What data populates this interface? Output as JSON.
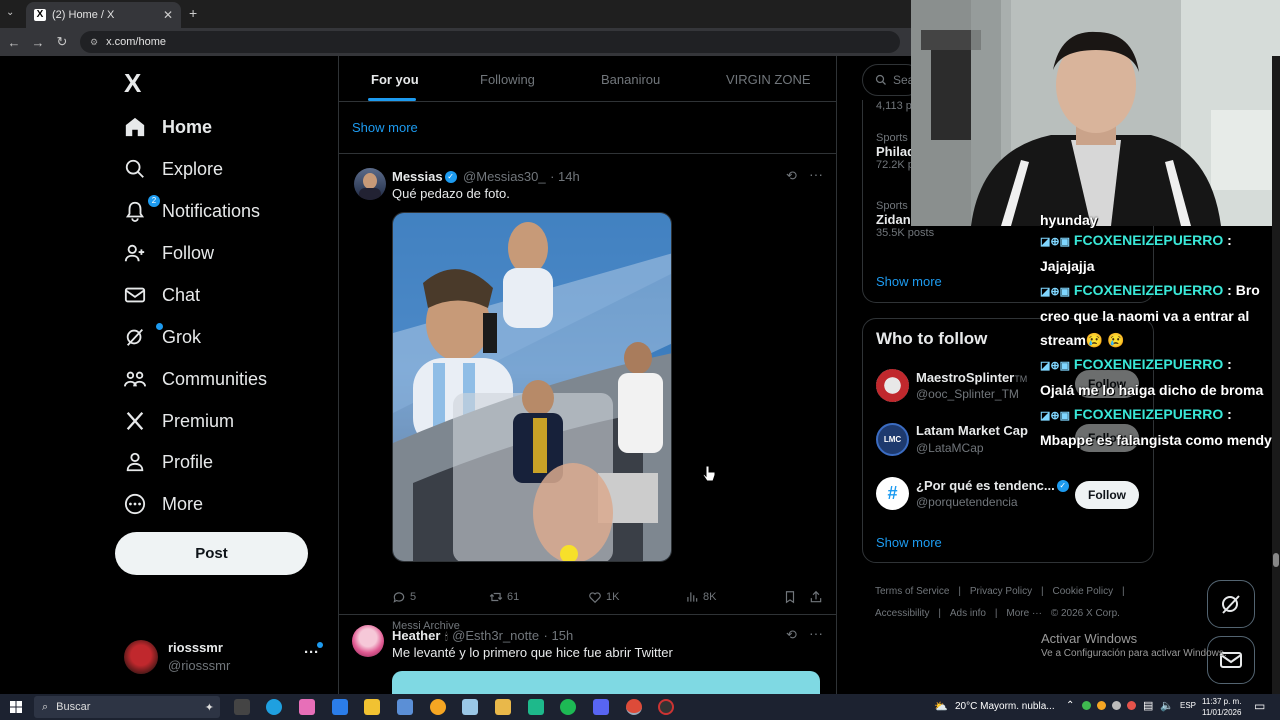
{
  "browser": {
    "tab_title": "(2) Home / X",
    "url": "x.com/home",
    "tab_close": "✕",
    "new_tab": "+"
  },
  "nav": {
    "logo": "X",
    "items": [
      {
        "label": "Home",
        "icon": "home-icon"
      },
      {
        "label": "Explore",
        "icon": "search-icon"
      },
      {
        "label": "Notifications",
        "icon": "bell-icon",
        "badge": "2"
      },
      {
        "label": "Follow",
        "icon": "person-add-icon"
      },
      {
        "label": "Chat",
        "icon": "mail-icon"
      },
      {
        "label": "Grok",
        "icon": "grok-icon"
      },
      {
        "label": "Communities",
        "icon": "people-icon"
      },
      {
        "label": "Premium",
        "icon": "x-premium-icon"
      },
      {
        "label": "Profile",
        "icon": "person-icon"
      },
      {
        "label": "More",
        "icon": "more-circle-icon"
      }
    ],
    "post_label": "Post",
    "account": {
      "name": "riosssmr",
      "handle": "@riosssmr",
      "menu": "···"
    }
  },
  "feed": {
    "tabs": [
      "For you",
      "Following",
      "Bananirou",
      "VIRGIN ZONE"
    ],
    "show_more": "Show more",
    "tweets": [
      {
        "name": "Messias",
        "handle": "@Messias30_",
        "time": "· 14h",
        "text": "Qué pedazo de foto.",
        "image_caption": "Messi Archive",
        "replies": "5",
        "retweets": "61",
        "likes": "1K",
        "views": "8K"
      },
      {
        "name": "Heather",
        "handle": "@Esth3r_notte",
        "time": "· 15h",
        "text": "Me levanté y lo primero que hice fue abrir Twitter"
      }
    ]
  },
  "sidebar": {
    "search_placeholder": "Sea",
    "trends": [
      {
        "posts": "4,113 p"
      },
      {
        "category": "Sports",
        "title": "Philad",
        "posts": "72.2K p"
      },
      {
        "category": "Sports",
        "title": "Zidane",
        "posts": "35.5K posts"
      }
    ],
    "show_more": "Show more",
    "who_to_follow_title": "Who to follow",
    "suggestions": [
      {
        "name": "MaestroSplinter",
        "suffix": "TM",
        "handle": "@ooc_Splinter_TM",
        "follow": "Follow"
      },
      {
        "name": "Latam Market Cap",
        "handle": "@LataMCap",
        "follow": "Follow",
        "avatar_text": "LMC"
      },
      {
        "name": "¿Por qué es tendenc...",
        "handle": "@porquetendencia",
        "follow": "Follow",
        "avatar_text": "#"
      }
    ],
    "show_more_2": "Show more",
    "footer": [
      "Terms of Service",
      "|",
      "Privacy Policy",
      "|",
      "Cookie Policy",
      "|",
      "Accessibility",
      "|",
      "Ads info",
      "|",
      "More ···",
      "© 2026 X Corp."
    ]
  },
  "chat": {
    "top_fragment": "hyunday",
    "lines": [
      {
        "user": "FCOXENEIZEPUERRO",
        "sep": " :",
        "msg": "Jajajajja"
      },
      {
        "user": "FCOXENEIZEPUERRO",
        "sep": " :",
        "msg": " Bro creo que la naomi va a entrar al stream😢 😢"
      },
      {
        "user": "FCOXENEIZEPUERRO",
        "sep": " :",
        "msg": "Ojalá me lo haiga dicho de broma"
      },
      {
        "user": "FCOXENEIZEPUERRO",
        "sep": " :",
        "msg": "Mbappe es falangista como mendy"
      }
    ]
  },
  "windows": {
    "activate_title": "Activar Windows",
    "activate_sub": "Ve a Configuración para activar Windows.",
    "search": "Buscar",
    "weather": "20°C  Mayorm. nubla...",
    "lang": "ESP",
    "time": "11:37 p. m.",
    "date": "11/01/2026"
  }
}
